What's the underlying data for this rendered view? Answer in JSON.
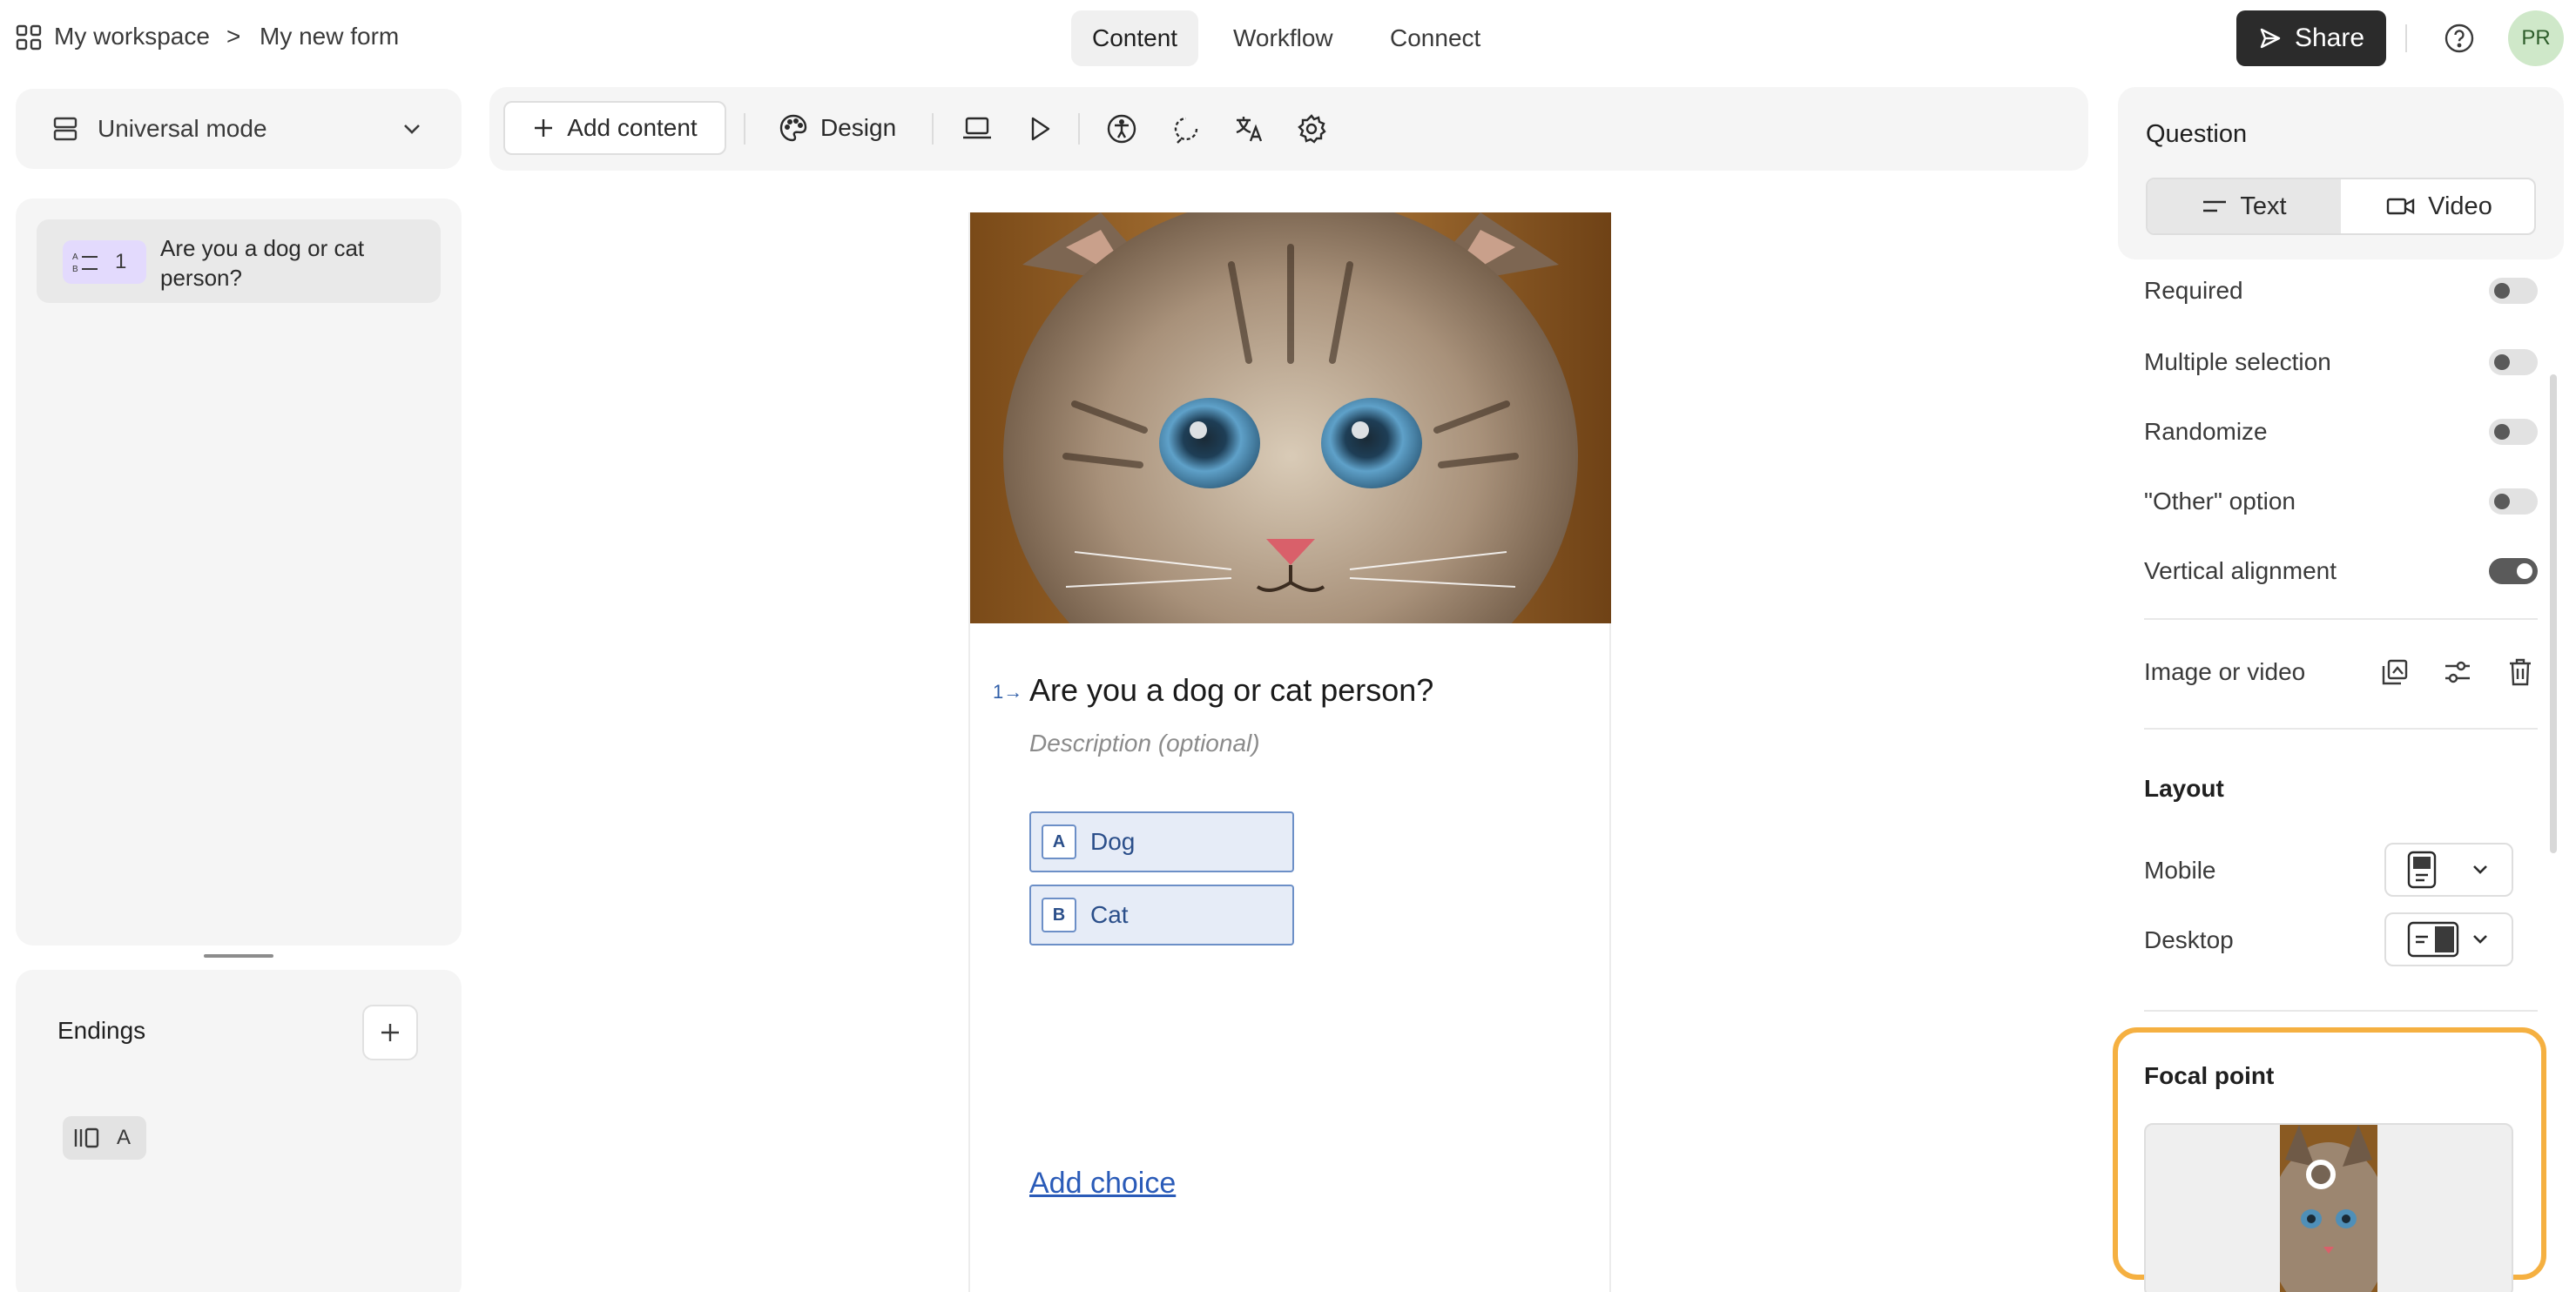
{
  "breadcrumb": {
    "workspace": "My workspace",
    "separator": ">",
    "form": "My new form"
  },
  "tabs": [
    {
      "label": "Content",
      "active": true
    },
    {
      "label": "Workflow",
      "active": false
    },
    {
      "label": "Connect",
      "active": false
    }
  ],
  "header": {
    "share_label": "Share",
    "avatar_initials": "PR"
  },
  "left": {
    "mode_label": "Universal mode",
    "questions": [
      {
        "number": "1",
        "title": "Are you a dog or cat person?"
      }
    ],
    "endings_title": "Endings",
    "endings": [
      {
        "label": "A"
      }
    ]
  },
  "toolbar": {
    "add_content_label": "Add content",
    "design_label": "Design"
  },
  "form": {
    "cover_image_subject": "kitten",
    "question_number": "1→",
    "question_title": "Are you a dog or cat person?",
    "description_placeholder": "Description (optional)",
    "choices": [
      {
        "key": "A",
        "label": "Dog"
      },
      {
        "key": "B",
        "label": "Cat"
      }
    ],
    "add_choice_label": "Add choice"
  },
  "right": {
    "question_title": "Question",
    "content_types": [
      {
        "label": "Text",
        "active": true
      },
      {
        "label": "Video",
        "active": false
      }
    ],
    "settings": [
      {
        "label": "Required",
        "on": false
      },
      {
        "label": "Multiple selection",
        "on": false
      },
      {
        "label": "Randomize",
        "on": false
      },
      {
        "label": "\"Other\" option",
        "on": false
      },
      {
        "label": "Vertical alignment",
        "on": true
      }
    ],
    "image_or_video_label": "Image or video",
    "layout_title": "Layout",
    "layout_mobile_label": "Mobile",
    "layout_desktop_label": "Desktop",
    "focal_point_title": "Focal point"
  },
  "colors": {
    "accent_dark": "#2b2b2b",
    "focal_highlight": "#f5b041",
    "choice_border": "#6c8fc7",
    "question_badge": "#e3dafd"
  }
}
